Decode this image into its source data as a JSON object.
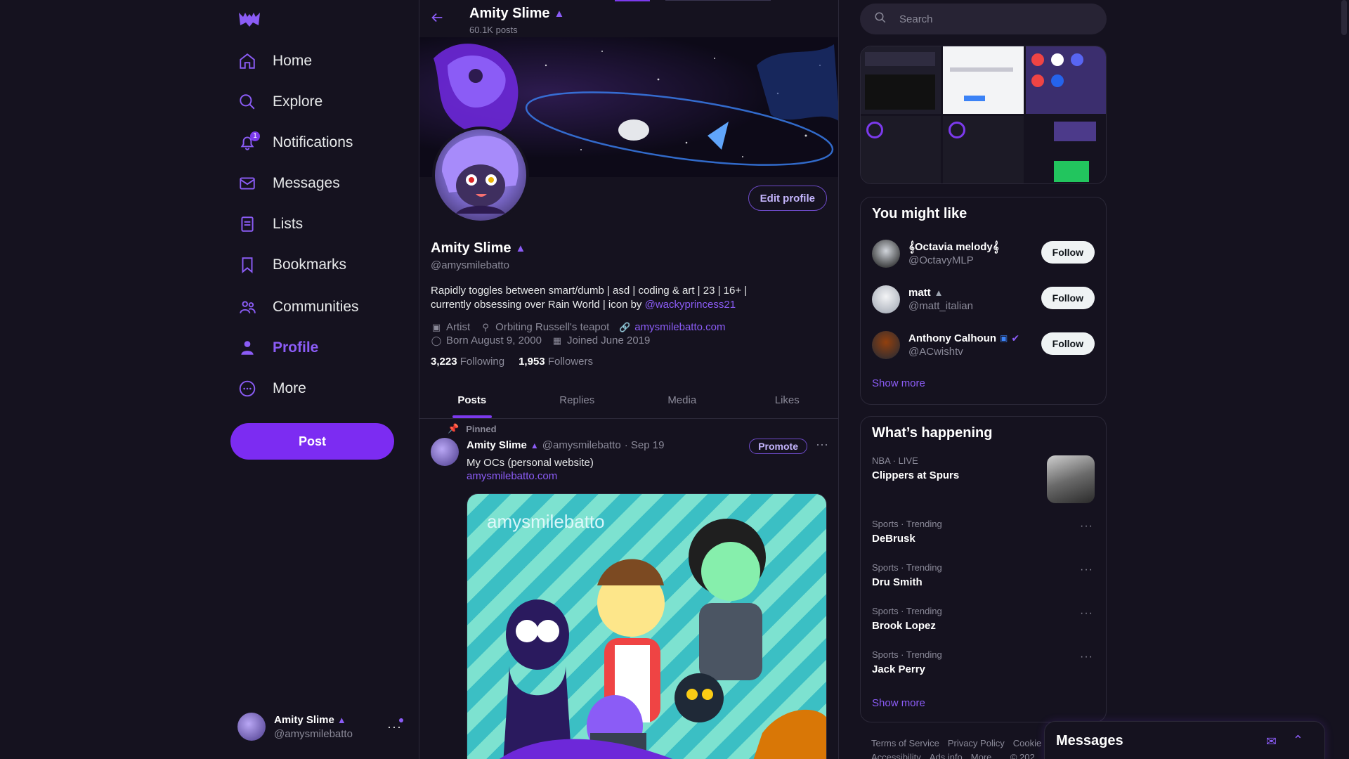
{
  "nav": {
    "items": [
      {
        "label": "Home",
        "icon": "home-icon"
      },
      {
        "label": "Explore",
        "icon": "search-icon"
      },
      {
        "label": "Notifications",
        "icon": "bell-icon",
        "badge": "1"
      },
      {
        "label": "Messages",
        "icon": "mail-icon"
      },
      {
        "label": "Lists",
        "icon": "list-icon"
      },
      {
        "label": "Bookmarks",
        "icon": "bookmark-icon"
      },
      {
        "label": "Communities",
        "icon": "people-icon"
      },
      {
        "label": "Profile",
        "icon": "person-icon",
        "active": true
      },
      {
        "label": "More",
        "icon": "more-circle-icon"
      }
    ],
    "post_button": "Post",
    "account": {
      "name": "Amity Slime",
      "handle": "@amysmilebatto"
    }
  },
  "header": {
    "title": "Amity Slime",
    "posts_count": "60.1K posts"
  },
  "profile": {
    "name": "Amity Slime",
    "handle": "@amysmilebatto",
    "edit_button": "Edit profile",
    "bio_line1": "Rapidly toggles between smart/dumb | asd | coding & art | 23 | 16+ |",
    "bio_line2_prefix": "currently obsessing over Rain World | icon by ",
    "bio_mention": "@wackyprincess21",
    "category": "Artist",
    "location": "Orbiting Russell's teapot",
    "website": "amysmilebatto.com",
    "born": "Born August 9, 2000",
    "joined": "Joined June 2019",
    "following_count": "3,223",
    "following_label": "Following",
    "followers_count": "1,953",
    "followers_label": "Followers"
  },
  "tabs": [
    "Posts",
    "Replies",
    "Media",
    "Likes"
  ],
  "pinned_post": {
    "pinned_label": "Pinned",
    "author": "Amity Slime",
    "handle": "@amysmilebatto",
    "date": "· Sep 19",
    "promote": "Promote",
    "text": "My OCs (personal website)",
    "link": "amysmilebatto.com",
    "image_watermark": "amysmilebatto"
  },
  "search": {
    "placeholder": "Search"
  },
  "who_to_follow": {
    "title": "You might like",
    "users": [
      {
        "name": "𝄞Octavia melody𝄞",
        "handle": "@OctavyMLP",
        "button": "Follow"
      },
      {
        "name": "matt",
        "handle": "@matt_italian",
        "button": "Follow"
      },
      {
        "name": "Anthony Calhoun",
        "handle": "@ACwishtv",
        "button": "Follow"
      }
    ],
    "show_more": "Show more"
  },
  "trends": {
    "title": "What’s happening",
    "items": [
      {
        "category": "NBA · LIVE",
        "title": "Clippers at Spurs"
      },
      {
        "category": "Sports · Trending",
        "title": "DeBrusk"
      },
      {
        "category": "Sports · Trending",
        "title": "Dru Smith"
      },
      {
        "category": "Sports · Trending",
        "title": "Brook Lopez"
      },
      {
        "category": "Sports · Trending",
        "title": "Jack Perry"
      }
    ],
    "show_more": "Show more"
  },
  "footer": {
    "links1": [
      "Terms of Service",
      "Privacy Policy",
      "Cookie"
    ],
    "links2": [
      "Accessibility",
      "Ads info",
      "More ...",
      "© 202"
    ]
  },
  "messages_drawer": {
    "title": "Messages"
  },
  "colors": {
    "accent": "#7c3aed",
    "link": "#8b5cf6",
    "background": "#15121f"
  }
}
